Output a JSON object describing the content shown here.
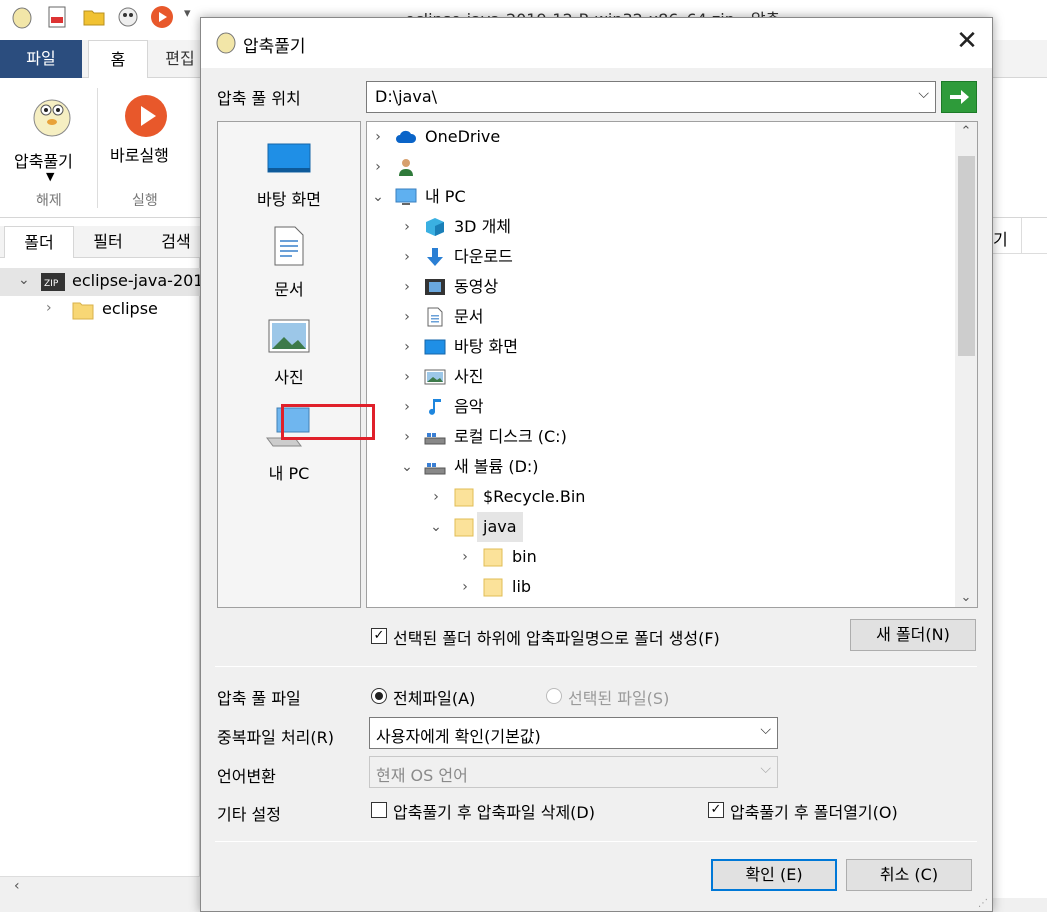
{
  "background": {
    "window_title": "eclipse-java-2019-12-R-win32-x86_64.zip - 압축",
    "ribbon_tabs": [
      "파일",
      "홈",
      "편집"
    ],
    "ribbon_buttons": [
      {
        "label": "압축풀기",
        "icon": "extract-icon"
      },
      {
        "label": "바로실행",
        "icon": "play-icon"
      }
    ],
    "ribbon_groups": [
      "해제",
      "실행"
    ],
    "panel_tabs": [
      "폴더",
      "필터",
      "검색"
    ],
    "tree_items": [
      {
        "label": "eclipse-java-201",
        "icon": "zip-icon"
      },
      {
        "label": "eclipse",
        "icon": "folder-icon"
      }
    ],
    "right_col_fragment": "기"
  },
  "dialog": {
    "title": "압축풀기",
    "close_glyph": "✕",
    "location_label": "압축 풀 위치",
    "path_value": "D:\\java\\",
    "places": [
      {
        "label": "바탕 화면",
        "icon": "desktop-icon"
      },
      {
        "label": "문서",
        "icon": "document-icon"
      },
      {
        "label": "사진",
        "icon": "picture-icon"
      },
      {
        "label": "내 PC",
        "icon": "computer-icon"
      }
    ],
    "tree": [
      {
        "label": "OneDrive",
        "icon": "cloud-icon",
        "expanded": false
      },
      {
        "label": "",
        "icon": "user-icon",
        "expanded": false
      },
      {
        "label": "내 PC",
        "icon": "computer-icon",
        "expanded": true
      },
      {
        "label": "3D 개체",
        "icon": "cube-icon",
        "expanded": false
      },
      {
        "label": "다운로드",
        "icon": "download-icon",
        "expanded": false
      },
      {
        "label": "동영상",
        "icon": "video-icon",
        "expanded": false
      },
      {
        "label": "문서",
        "icon": "document-icon",
        "expanded": false
      },
      {
        "label": "바탕 화면",
        "icon": "desktop-icon",
        "expanded": false
      },
      {
        "label": "사진",
        "icon": "picture-icon",
        "expanded": false
      },
      {
        "label": "음악",
        "icon": "music-icon",
        "expanded": false
      },
      {
        "label": "로컬 디스크 (C:)",
        "icon": "drive-icon",
        "expanded": false
      },
      {
        "label": "새 볼륨 (D:)",
        "icon": "drive-icon",
        "expanded": true
      },
      {
        "label": "$Recycle.Bin",
        "icon": "folder-icon",
        "expanded": false
      },
      {
        "label": "java",
        "icon": "folder-icon",
        "expanded": true,
        "selected": true
      },
      {
        "label": "bin",
        "icon": "folder-icon",
        "expanded": false
      },
      {
        "label": "lib",
        "icon": "folder-icon",
        "expanded": false
      }
    ],
    "create_subfolder_label": "선택된 폴더 하위에 압축파일명으로 폴더 생성(F)",
    "create_subfolder_checked": true,
    "new_folder_button": "새 폴더(N)",
    "files_label": "압축 풀 파일",
    "radio_all": "전체파일(A)",
    "radio_selected": "선택된 파일(S)",
    "overwrite_label": "중복파일 처리(R)",
    "overwrite_value": "사용자에게 확인(기본값)",
    "language_label": "언어변환",
    "language_value": "현재 OS 언어",
    "etc_label": "기타 설정",
    "delete_after_label": "압축풀기 후 압축파일 삭제(D)",
    "delete_after_checked": false,
    "open_folder_label": "압축풀기 후 폴더열기(O)",
    "open_folder_checked": true,
    "ok_button": "확인 (E)",
    "cancel_button": "취소 (C)"
  },
  "colors": {
    "file_tab": "#2b4d7e",
    "go_button": "#2e9b3a",
    "highlight": "#e0202a",
    "default_button_border": "#0078d7"
  }
}
